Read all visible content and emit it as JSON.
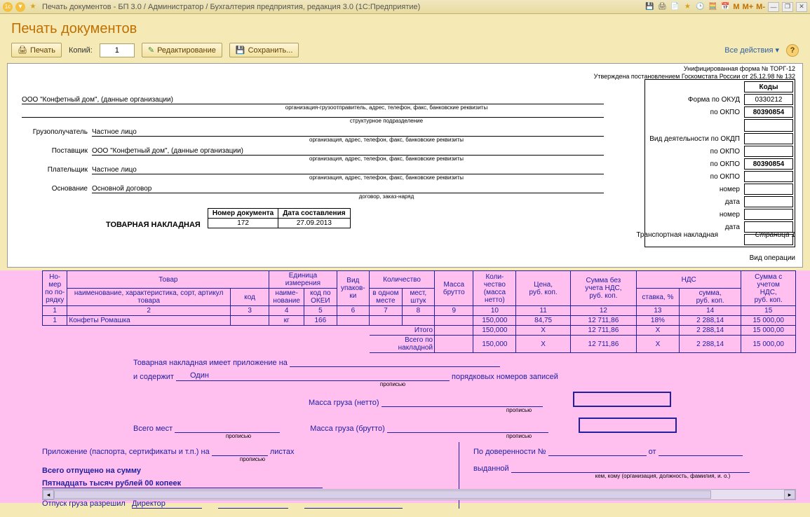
{
  "titlebar": {
    "text": "Печать документов - БП 3.0 / Администратор / Бухгалтерия предприятия, редакция 3.0  (1С:Предприятие)",
    "mem": [
      "M",
      "M+",
      "M-"
    ]
  },
  "page": {
    "title": "Печать документов"
  },
  "toolbar": {
    "print": "Печать",
    "copies_lbl": "Копий:",
    "copies_val": "1",
    "edit": "Редактирование",
    "save": "Сохранить...",
    "all_actions": "Все действия ▾"
  },
  "doc": {
    "form_code_lbl": "Унифицированная форма № ТОРГ-12",
    "approved": "Утверждена постановлением Госкомстата России от 25.12.98 № 132",
    "codes_hdr": "Коды",
    "okud_lbl": "Форма по ОКУД",
    "okud_val": "0330212",
    "okpo_lbl": "по ОКПО",
    "okpo_val": "80390854",
    "okdp_lbl": "Вид деятельности по ОКДП",
    "okpo2_lbl": "по ОКПО",
    "okpo2_val": "",
    "okpo3_lbl": "по ОКПО",
    "okpo3_val": "80390854",
    "okpo4_lbl": "по ОКПО",
    "okpo4_val": "",
    "nomer_lbl": "номер",
    "data_lbl": "дата",
    "org": "ООО \"Конфетный дом\", (данные организации)",
    "org_sub": "организация-грузоотправитель, адрес, телефон, факс, банковские реквизиты",
    "struct_sub": "структурное подразделение",
    "gp_lbl": "Грузополучатель",
    "gp_val": "Частное лицо",
    "gp_sub": "организация, адрес, телефон, факс, банковские реквизиты",
    "post_lbl": "Поставщик",
    "post_val": "ООО \"Конфетный дом\", (данные организации)",
    "plat_lbl": "Плательщик",
    "plat_val": "Частное лицо",
    "osn_lbl": "Основание",
    "osn_val": "Основной договор",
    "osn_sub": "договор, заказ-наряд",
    "docname": "ТОВАРНАЯ НАКЛАДНАЯ",
    "nd_hdr1": "Номер документа",
    "nd_hdr2": "Дата составления",
    "nd_val1": "172",
    "nd_val2": "27.09.2013",
    "transp": "Транспортная накладная",
    "vid_oper": "Вид операции",
    "page1": "Страница 1"
  },
  "grid": {
    "hdr": {
      "nom": "Но-\nмер\nпо по-\nрядку",
      "tovar": "Товар",
      "name": "наименование, характеристика, сорт, артикул товара",
      "kod": "код",
      "ed": "Единица измерения",
      "ed_name": "наиме-\nнование",
      "okei": "код по ОКЕИ",
      "vid_up": "Вид\nупаков-\nки",
      "kolvo": "Количество",
      "one": "в одном месте",
      "mest": "мест, штук",
      "brutto": "Масса брутто",
      "netto": "Коли-\nчество\n(масса\nнетто)",
      "price": "Цена,\nруб. коп.",
      "sum_no_nds": "Сумма без\nучета НДС,\nруб. коп.",
      "nds": "НДС",
      "rate": "ставка, %",
      "nds_sum": "сумма,\nруб. коп.",
      "sum_nds": "Сумма с\nучетом\nНДС,\nруб. коп."
    },
    "nums": [
      "1",
      "2",
      "3",
      "4",
      "5",
      "6",
      "7",
      "8",
      "9",
      "10",
      "11",
      "12",
      "13",
      "14",
      "15"
    ],
    "row": {
      "n": "1",
      "name": "Конфеты Ромашка",
      "kod": "",
      "ed": "кг",
      "okei": "166",
      "vid": "",
      "one": "",
      "mest": "",
      "brutto": "",
      "netto": "150,000",
      "price": "84,75",
      "sum": "12 711,86",
      "rate": "18%",
      "nds": "2 288,14",
      "total": "15 000,00"
    },
    "itogo_lbl": "Итого",
    "vsego_lbl": "Всего по накладной",
    "itogo": {
      "netto": "150,000",
      "price": "X",
      "sum": "12 711,86",
      "rate": "X",
      "nds": "2 288,14",
      "total": "15 000,00"
    },
    "vsego": {
      "netto": "150,000",
      "price": "X",
      "sum": "12 711,86",
      "rate": "X",
      "nds": "2 288,14",
      "total": "15 000,00"
    }
  },
  "footer": {
    "line1a": "Товарная накладная имеет приложение на",
    "line1b": "и содержит",
    "odin": "Один",
    "line1c": "порядковых номеров записей",
    "prop": "прописью",
    "netto": "Масса груза (нетто)",
    "brutto": "Масса груза (брутто)",
    "vsego_mest": "Всего мест",
    "pril": "Приложение (паспорта, сертификаты и т.п.) на",
    "list": "листах",
    "dov": "По доверенности №",
    "ot": "от",
    "vyd": "выданной",
    "kem": "кем, кому (организация, должность, фамилия, и. о.)",
    "vsego_otp": "Всего отпущено  на сумму",
    "summa": "Пятнадцать тысяч рублей 00 копеек",
    "otpusk": "Отпуск груза разрешил",
    "dir": "Директор"
  }
}
